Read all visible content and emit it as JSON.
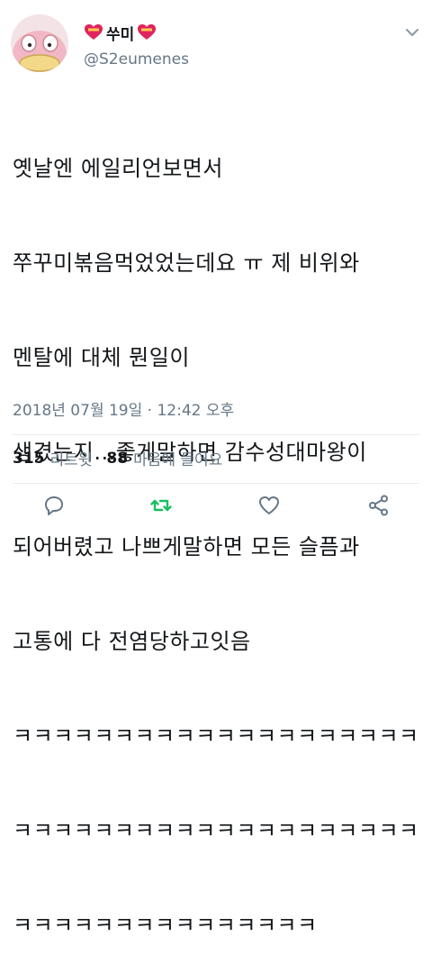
{
  "user": {
    "display_name": "쑤미",
    "handle": "@S2eumenes",
    "name_badge_icon": "heart-badge-icon"
  },
  "tweet": {
    "lines": [
      "옛날엔 에일리언보면서",
      "쭈꾸미볶음먹었었는데요 ㅠ 제 비위와",
      "멘탈에 대체 뭔일이",
      "생겼는지...좋게말하면 감수성대마왕이",
      "되어버렸고 나쁘게말하면 모든 슬픔과",
      "고통에 다 전염당하고잇음",
      "ㅋㅋㅋㅋㅋㅋㅋㅋㅋㅋㅋㅋㅋㅋㅋㅋㅋㅋㅋㅋ",
      "ㅋㅋㅋㅋㅋㅋㅋㅋㅋㅋㅋㅋㅋㅋㅋㅋㅋㅋㅋㅋ",
      "ㅋㅋㅋㅋㅋㅋㅋㅋㅋㅋㅋㅋㅋㅋㅋ"
    ],
    "timestamp": "2018년 07월 19일 · 12:42 오후"
  },
  "stats": {
    "retweets_count": "315",
    "retweets_label": "리트윗",
    "likes_count": "88",
    "likes_label": "마음에 들어요"
  },
  "colors": {
    "text": "#14171a",
    "secondary": "#657786",
    "retweet_green": "#17bf63",
    "divider": "#e6ecf0",
    "heart_badge": "#e0245e"
  },
  "actions": [
    "reply-icon",
    "retweet-icon",
    "like-icon",
    "share-icon"
  ]
}
